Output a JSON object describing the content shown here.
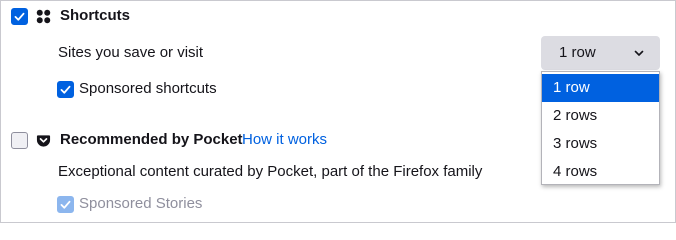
{
  "shortcuts": {
    "label": "Shortcuts",
    "checked": true,
    "icon": "grid-icon",
    "sites_label": "Sites you save or visit",
    "rows_select": {
      "value": "1 row",
      "options": [
        "1 row",
        "2 rows",
        "3 rows",
        "4 rows"
      ],
      "selected_index": 0
    },
    "sponsored": {
      "label": "Sponsored shortcuts",
      "checked": true
    }
  },
  "pocket": {
    "label": "Recommended by Pocket",
    "checked": false,
    "icon": "pocket-icon",
    "link": "How it works",
    "description": "Exceptional content curated by Pocket, part of the Firefox family",
    "sponsored_stories": {
      "label": "Sponsored Stories",
      "checked": true,
      "disabled": true
    }
  },
  "colors": {
    "accent": "#0061e0",
    "select_bg": "#dcdce2",
    "muted_text": "#8f8f9d"
  }
}
